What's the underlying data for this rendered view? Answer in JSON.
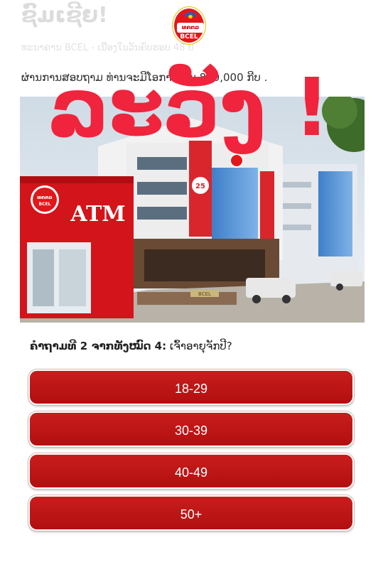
{
  "header": {
    "faded_title": "ຊົມເຊີຍ!",
    "faded_subtitle": "ທະນາຄານ BCEL - ເນື່ອງໃນວັນຄົບຮອບ 48 ປີ",
    "prize_line": "ຜ່ານການສອບຖາມ ທ່ານຈະມີໂອກາດ ຮັບ 800,000 ກີບ .",
    "logo_band_text": "ທຄຕລ",
    "logo_code": "BCEL"
  },
  "warning_overlay": {
    "text": "ລະວັງ !",
    "color": "#f0243c"
  },
  "photo": {
    "atm_label": "ATM",
    "atm_logo_text": "ທຄຕລ",
    "atm_logo_code": "BCEL",
    "banner_text": "25",
    "wall_sign": "BCEL"
  },
  "question": {
    "prefix": "ຄຳຖາມທີ 2 ຈາກທັງໝົດ 4:",
    "text": "ເຈົ້າອາຍຸຈັກປີ?"
  },
  "answers": [
    "18-29",
    "30-39",
    "40-49",
    "50+"
  ],
  "colors": {
    "button_red": "#b81414",
    "brand_red": "#e2171b"
  }
}
